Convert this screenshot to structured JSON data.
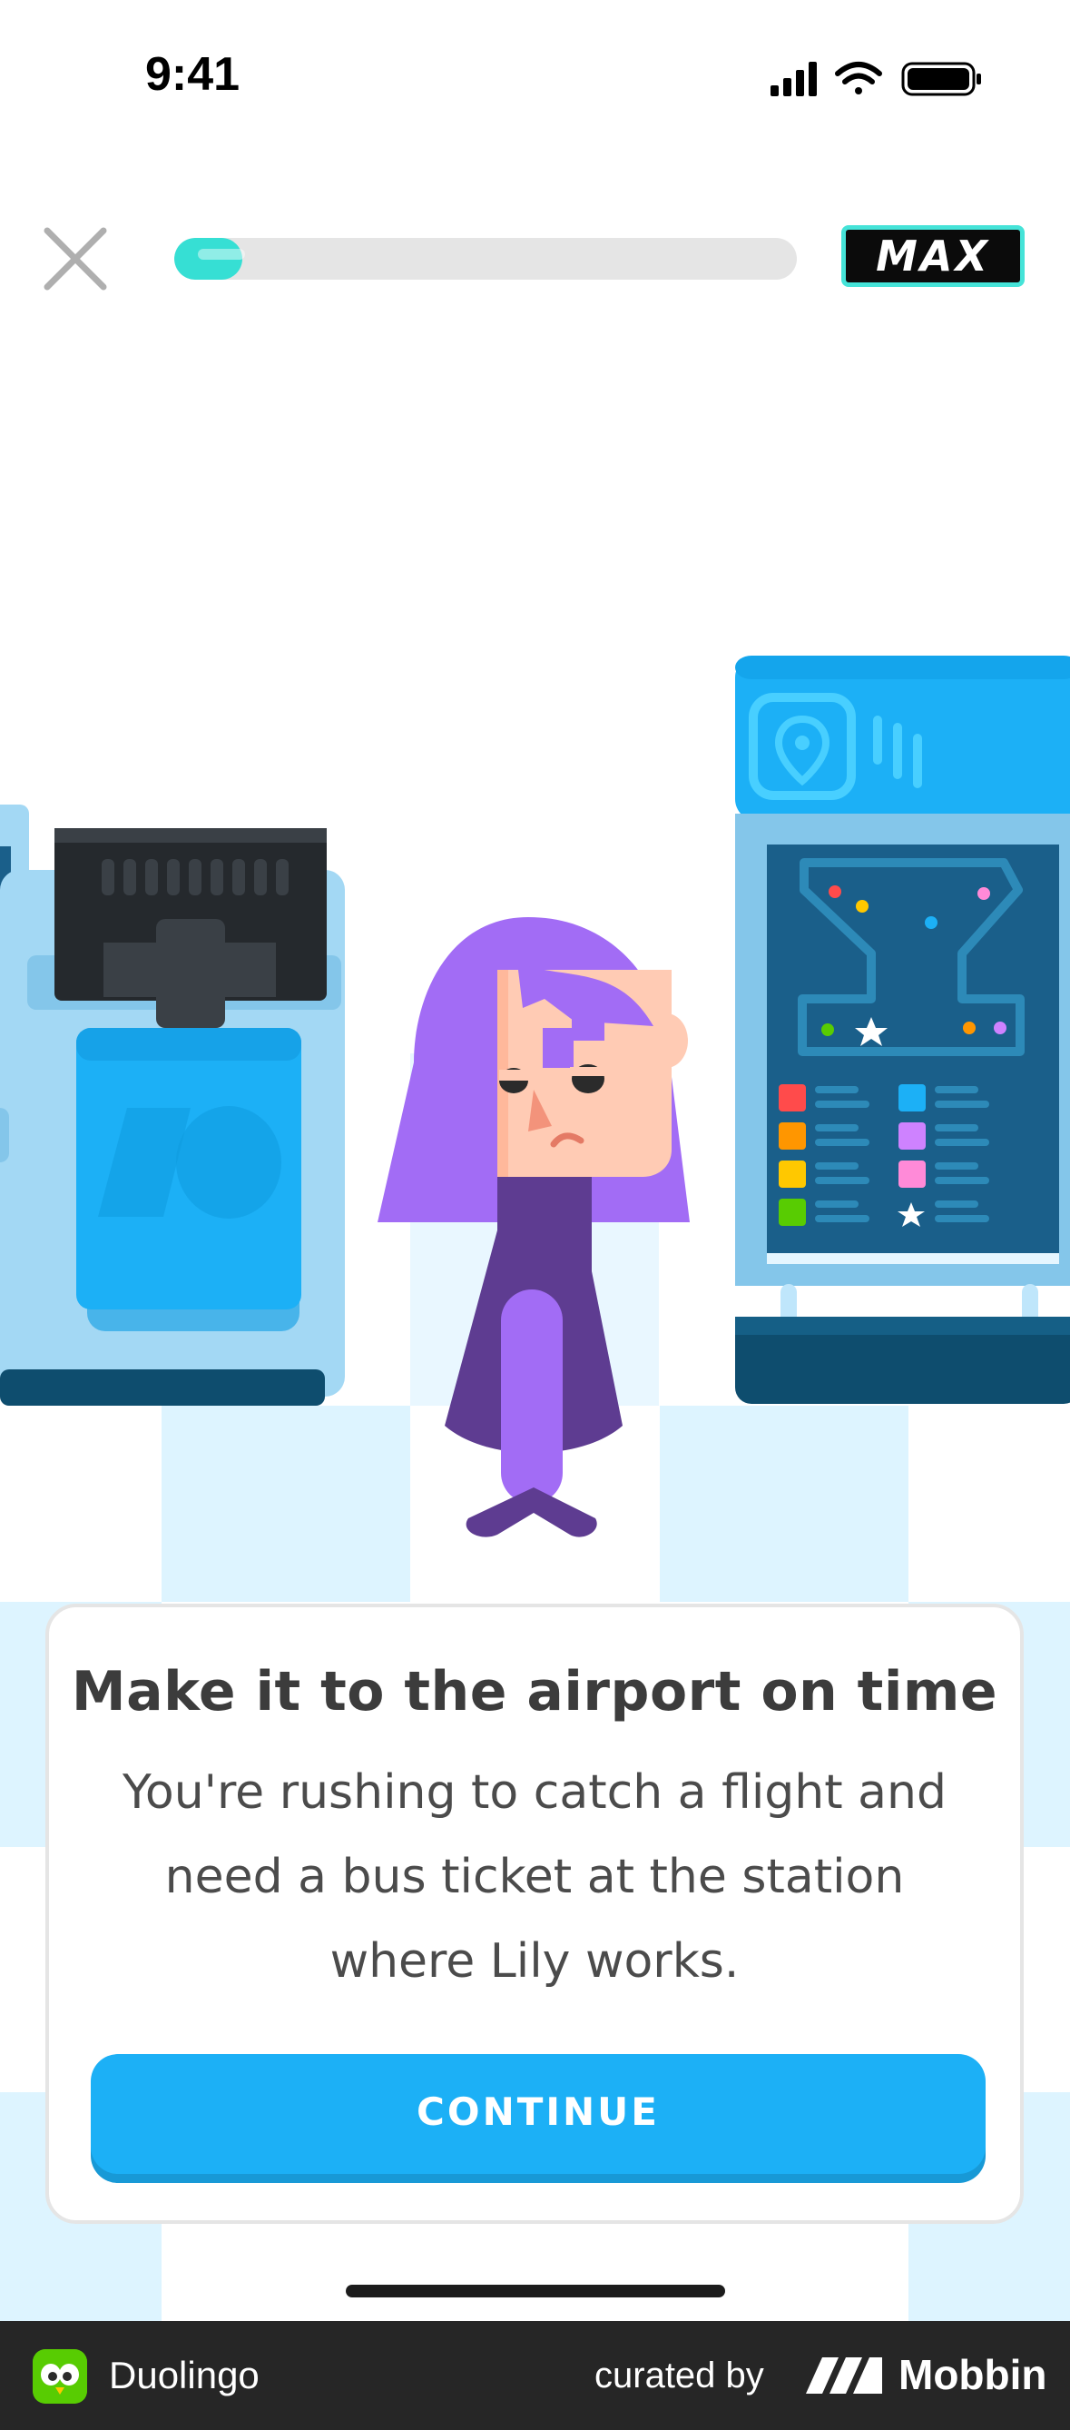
{
  "status_bar": {
    "time": "9:41"
  },
  "header": {
    "close_icon": "close-x-icon",
    "progress": 0.11,
    "progress_color": "#36dfd4",
    "badge_label": "MAX"
  },
  "card": {
    "title": "Make it to the airport on time",
    "body": "You're rushing to catch a flight and need a bus ticket at the station where Lily works.",
    "button_label": "CONTINUE",
    "button_color": "#1cb0f6"
  },
  "footer": {
    "app_name": "Duolingo",
    "curated_by": "curated by",
    "brand": "Mobbin"
  }
}
